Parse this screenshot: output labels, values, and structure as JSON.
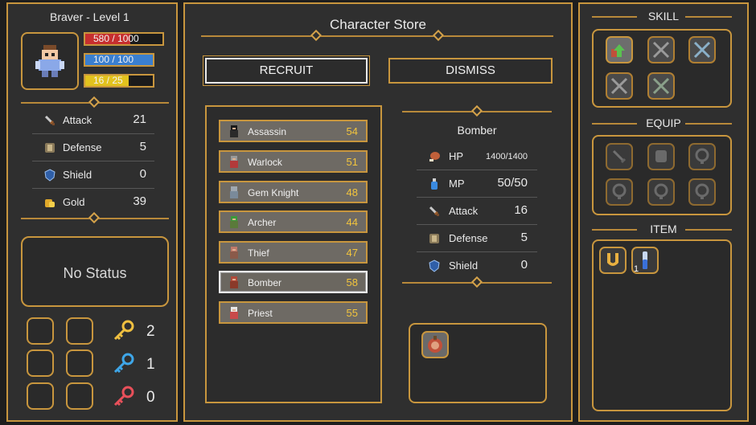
{
  "player": {
    "title": "Braver  -  Level 1",
    "hp": "580 / 1000",
    "mp": "100 / 100",
    "xp": "16 / 25",
    "hp_fraction": 0.58,
    "mp_fraction": 1.0,
    "xp_fraction": 0.64
  },
  "stats": [
    {
      "label": "Attack",
      "value": "21",
      "icon": "sword-icon"
    },
    {
      "label": "Defense",
      "value": "5",
      "icon": "armor-icon"
    },
    {
      "label": "Shield",
      "value": "0",
      "icon": "shield-icon"
    },
    {
      "label": "Gold",
      "value": "39",
      "icon": "gold-icon"
    }
  ],
  "status": {
    "text": "No Status"
  },
  "keys": [
    {
      "color": "#f0c040",
      "count": "2",
      "name": "gold-key-icon"
    },
    {
      "color": "#3ea6e8",
      "count": "1",
      "name": "blue-key-icon"
    },
    {
      "color": "#e8505a",
      "count": "0",
      "name": "red-key-icon"
    }
  ],
  "store": {
    "title": "Character Store",
    "recruit_label": "RECRUIT",
    "dismiss_label": "DISMISS",
    "characters": [
      {
        "name": "Assassin",
        "price": "54"
      },
      {
        "name": "Warlock",
        "price": "51"
      },
      {
        "name": "Gem Knight",
        "price": "48"
      },
      {
        "name": "Archer",
        "price": "44"
      },
      {
        "name": "Thief",
        "price": "47"
      },
      {
        "name": "Bomber",
        "price": "58"
      },
      {
        "name": "Priest",
        "price": "55"
      }
    ],
    "selected_index": 5
  },
  "detail": {
    "name": "Bomber",
    "rows": [
      {
        "label": "HP",
        "value": "1400/1400",
        "icon": "meat-icon"
      },
      {
        "label": "MP",
        "value": "50/50",
        "icon": "potion-icon"
      },
      {
        "label": "Attack",
        "value": "16",
        "icon": "sword-icon"
      },
      {
        "label": "Defense",
        "value": "5",
        "icon": "armor-icon"
      },
      {
        "label": "Shield",
        "value": "0",
        "icon": "shield-icon"
      }
    ]
  },
  "right": {
    "skill_title": "SKILL",
    "equip_title": "EQUIP",
    "item_title": "ITEM",
    "item_count": "1"
  },
  "colors": {
    "gold_border": "#c8963e",
    "panel": "#2f2f2f",
    "price": "#f3c53c",
    "hp_bar": "#c62f2f",
    "mp_bar": "#3a7fd0",
    "xp_bar": "#e2c21e"
  }
}
